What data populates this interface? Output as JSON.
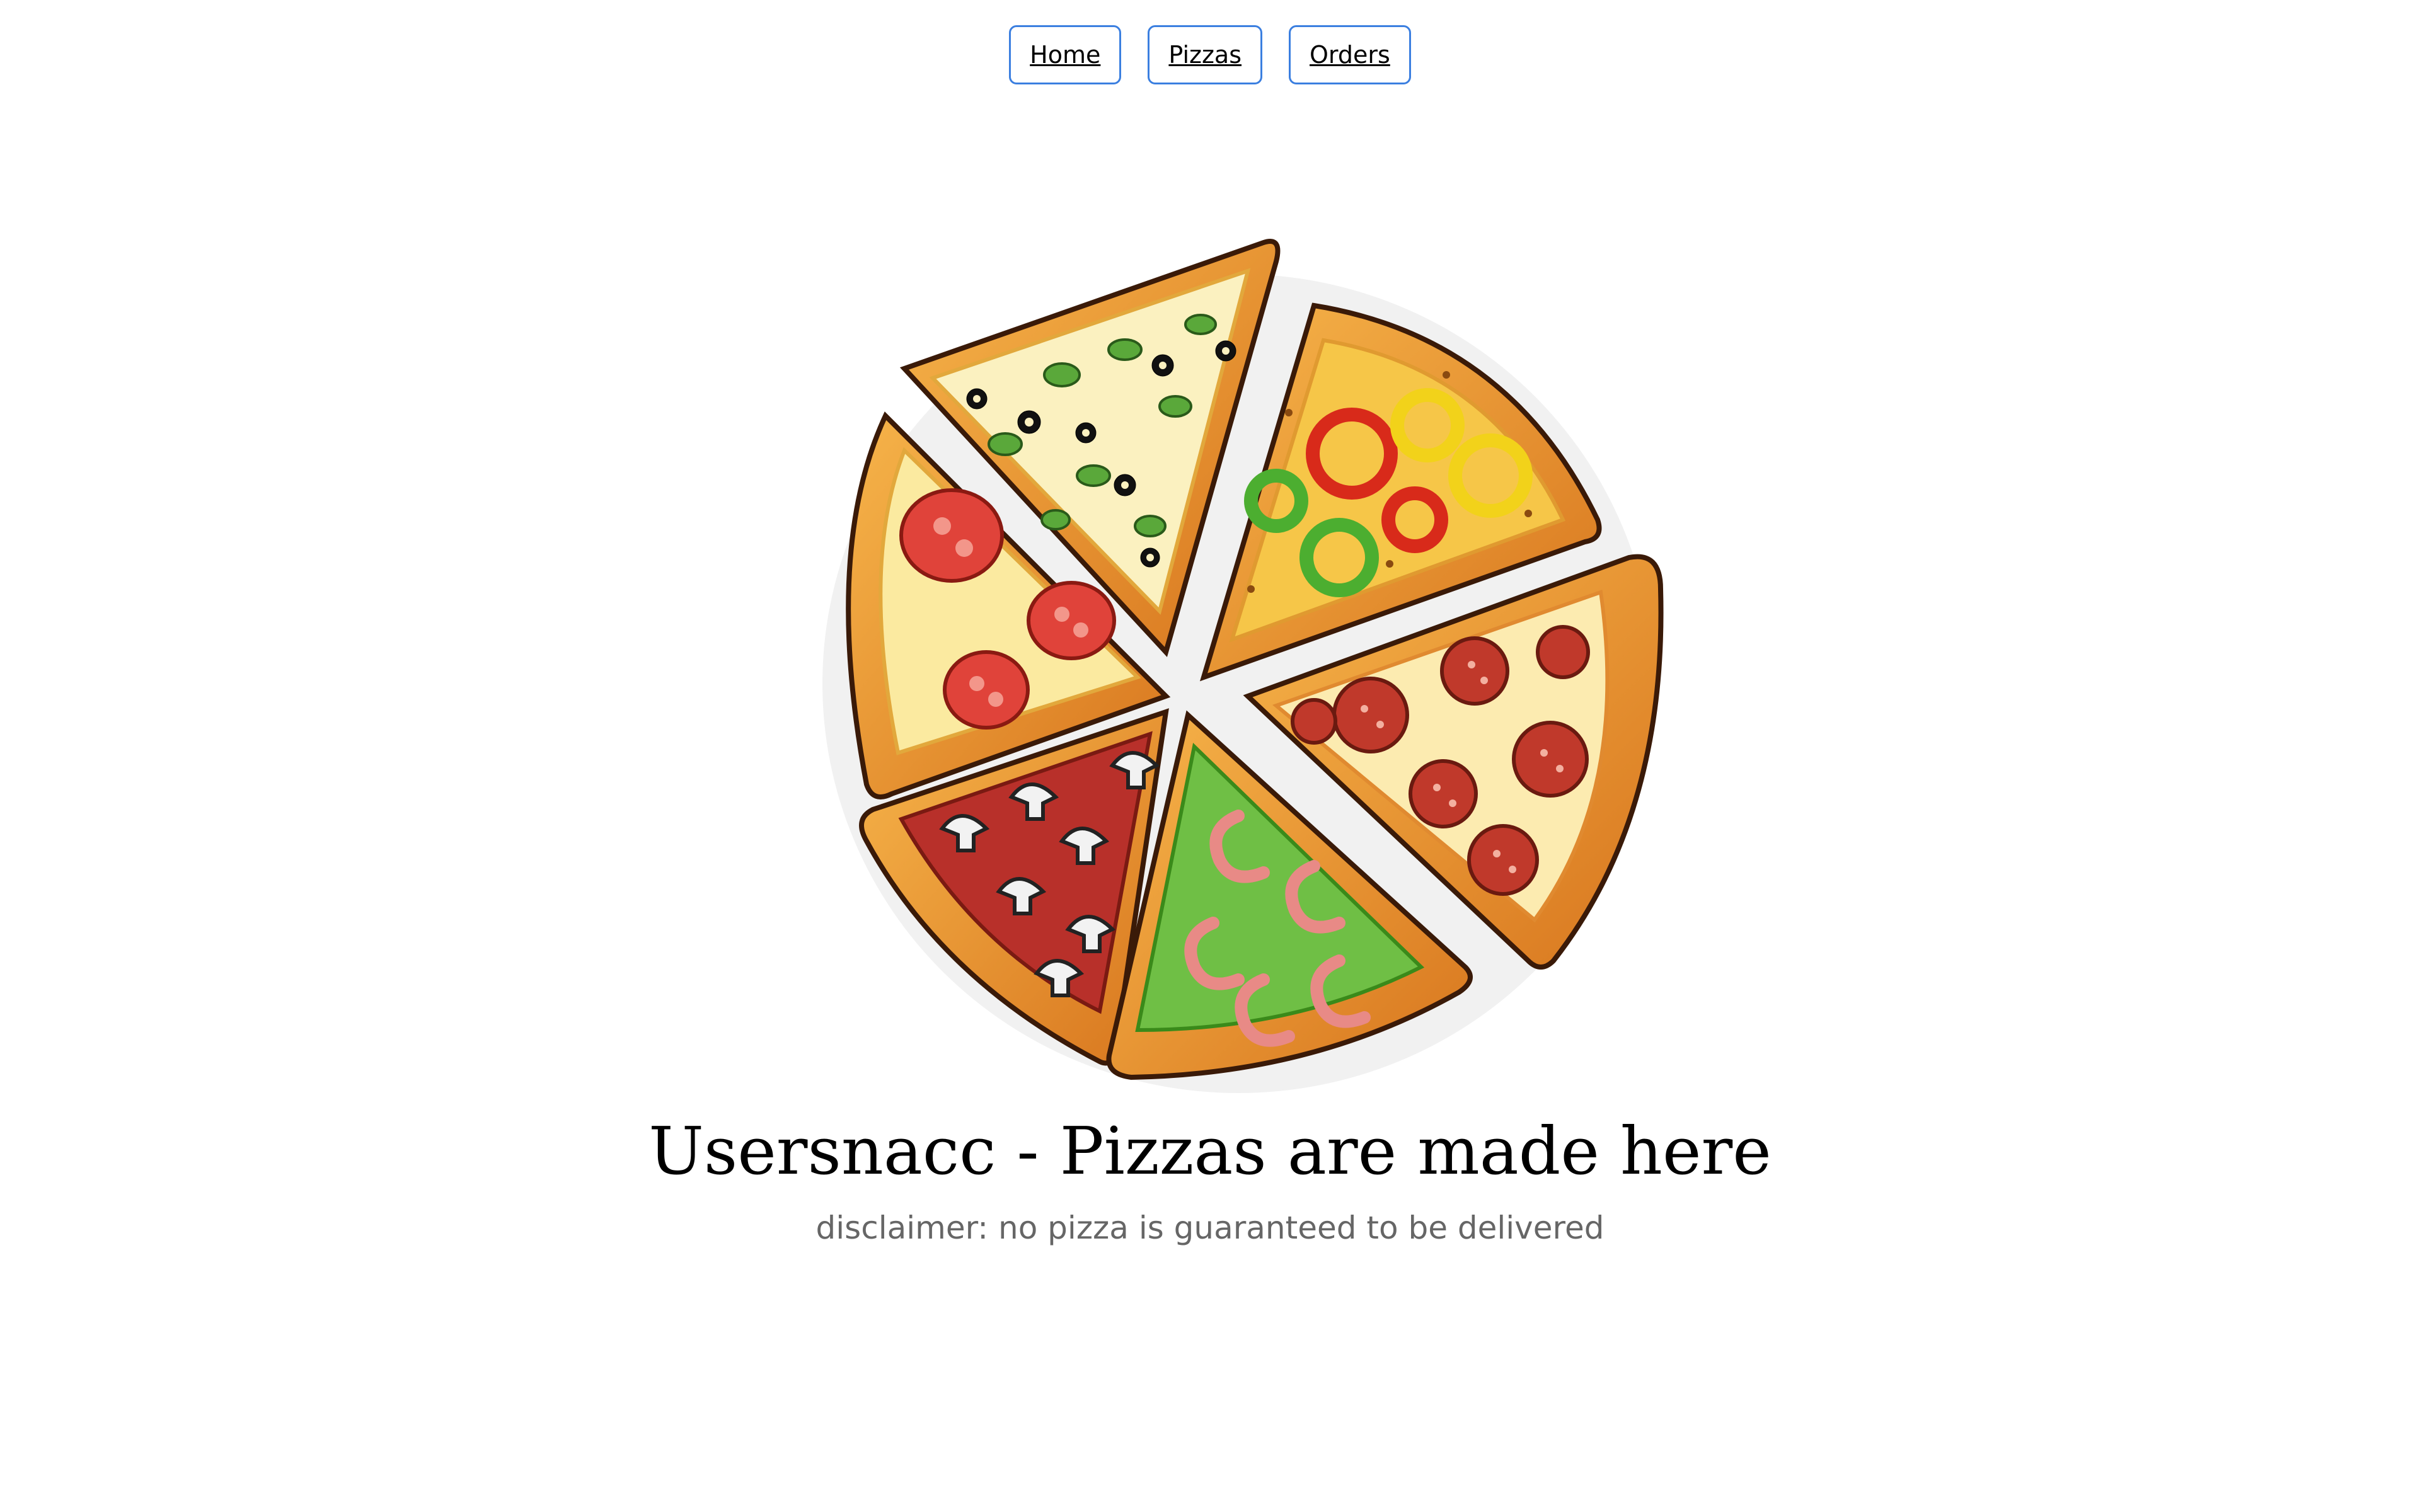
{
  "nav": {
    "items": [
      {
        "label": "Home"
      },
      {
        "label": "Pizzas"
      },
      {
        "label": "Orders"
      }
    ],
    "accent_color": "#3b7fe0"
  },
  "hero": {
    "image_icon": "pizza-illustration-icon",
    "title": "Usersnacc - Pizzas are made here",
    "subtitle": "disclaimer: no pizza is guaranteed to be delivered"
  }
}
